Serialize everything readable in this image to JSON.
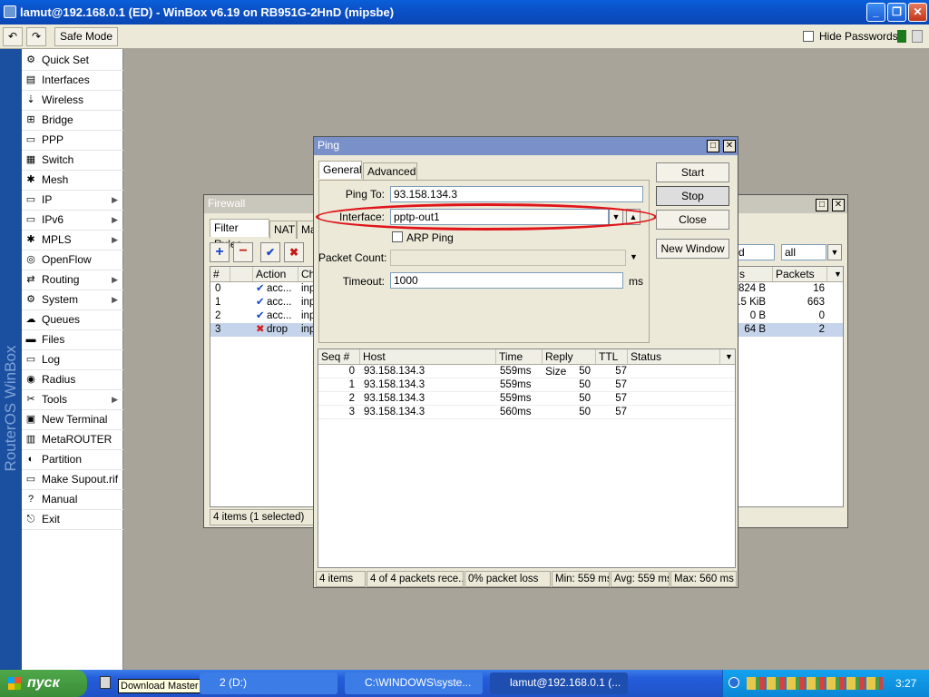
{
  "window": {
    "title": "lamut@192.168.0.1 (ED) - WinBox v6.19 on RB951G-2HnD (mipsbe)"
  },
  "toolbar": {
    "undo_icon": "undo-icon",
    "redo_icon": "redo-icon",
    "safe_mode": "Safe Mode",
    "hide_passwords": "Hide Passwords"
  },
  "sidebar": {
    "brand": "RouterOS WinBox",
    "items": [
      {
        "label": "Quick Set",
        "icon": "quick-set-icon"
      },
      {
        "label": "Interfaces",
        "icon": "interfaces-icon"
      },
      {
        "label": "Wireless",
        "icon": "wireless-icon"
      },
      {
        "label": "Bridge",
        "icon": "bridge-icon"
      },
      {
        "label": "PPP",
        "icon": "ppp-icon"
      },
      {
        "label": "Switch",
        "icon": "switch-icon"
      },
      {
        "label": "Mesh",
        "icon": "mesh-icon"
      },
      {
        "label": "IP",
        "icon": "ip-icon",
        "submenu": true
      },
      {
        "label": "IPv6",
        "icon": "ipv6-icon",
        "submenu": true
      },
      {
        "label": "MPLS",
        "icon": "mpls-icon",
        "submenu": true
      },
      {
        "label": "OpenFlow",
        "icon": "openflow-icon"
      },
      {
        "label": "Routing",
        "icon": "routing-icon",
        "submenu": true
      },
      {
        "label": "System",
        "icon": "system-icon",
        "submenu": true
      },
      {
        "label": "Queues",
        "icon": "queues-icon"
      },
      {
        "label": "Files",
        "icon": "files-icon"
      },
      {
        "label": "Log",
        "icon": "log-icon"
      },
      {
        "label": "Radius",
        "icon": "radius-icon"
      },
      {
        "label": "Tools",
        "icon": "tools-icon",
        "submenu": true
      },
      {
        "label": "New Terminal",
        "icon": "terminal-icon"
      },
      {
        "label": "MetaROUTER",
        "icon": "metarouter-icon"
      },
      {
        "label": "Partition",
        "icon": "partition-icon"
      },
      {
        "label": "Make Supout.rif",
        "icon": "supout-icon"
      },
      {
        "label": "Manual",
        "icon": "manual-icon"
      },
      {
        "label": "Exit",
        "icon": "exit-icon"
      }
    ]
  },
  "firewall": {
    "title": "Firewall",
    "tabs": [
      "Filter Rules",
      "NAT",
      "Ma"
    ],
    "filter_field": "d",
    "filter_select": "all",
    "columns": {
      "num": "#",
      "action": "Action",
      "chain": "Cha",
      "bytes": "s",
      "packets": "Packets"
    },
    "rows": [
      {
        "num": "0",
        "action": "acc...",
        "chain": "inpu",
        "bytes": "824 B",
        "packets": "16"
      },
      {
        "num": "1",
        "action": "acc...",
        "chain": "inpu",
        "bytes": "8.5 KiB",
        "packets": "663"
      },
      {
        "num": "2",
        "action": "acc...",
        "chain": "inpu",
        "bytes": "0 B",
        "packets": "0"
      },
      {
        "num": "3",
        "action": "drop",
        "chain": "inpu",
        "bytes": "64 B",
        "packets": "2"
      }
    ],
    "status": "4 items (1 selected)"
  },
  "ping": {
    "title": "Ping",
    "tabs": [
      "General",
      "Advanced"
    ],
    "ping_to_label": "Ping To:",
    "ping_to": "93.158.134.3",
    "interface_label": "Interface:",
    "interface": "pptp-out1",
    "arp_ping": "ARP Ping",
    "packet_count_label": "Packet Count:",
    "packet_count": "",
    "timeout_label": "Timeout:",
    "timeout": "1000",
    "timeout_unit": "ms",
    "buttons": {
      "start": "Start",
      "stop": "Stop",
      "close": "Close",
      "new_window": "New Window"
    },
    "columns": {
      "seq": "Seq #",
      "host": "Host",
      "time": "Time",
      "reply_size": "Reply Size",
      "ttl": "TTL",
      "status": "Status"
    },
    "rows": [
      {
        "seq": "0",
        "host": "93.158.134.3",
        "time": "559ms",
        "reply_size": "50",
        "ttl": "57"
      },
      {
        "seq": "1",
        "host": "93.158.134.3",
        "time": "559ms",
        "reply_size": "50",
        "ttl": "57"
      },
      {
        "seq": "2",
        "host": "93.158.134.3",
        "time": "559ms",
        "reply_size": "50",
        "ttl": "57"
      },
      {
        "seq": "3",
        "host": "93.158.134.3",
        "time": "560ms",
        "reply_size": "50",
        "ttl": "57"
      }
    ],
    "status": {
      "items": "4 items",
      "received": "4 of 4 packets rece...",
      "loss": "0% packet loss",
      "min": "Min: 559 ms",
      "avg": "Avg: 559 ms",
      "max": "Max: 560 ms"
    }
  },
  "taskbar": {
    "start": "пуск",
    "tooltip": "Download Master",
    "tasks": [
      "2 (D:)",
      "C:\\WINDOWS\\syste...",
      "lamut@192.168.0.1 (..."
    ],
    "clock": "3:27"
  },
  "colors": {
    "selection": "#c5d4ea",
    "annotation": "#e0151a",
    "sidebar_strip": "#1b4fa0"
  }
}
